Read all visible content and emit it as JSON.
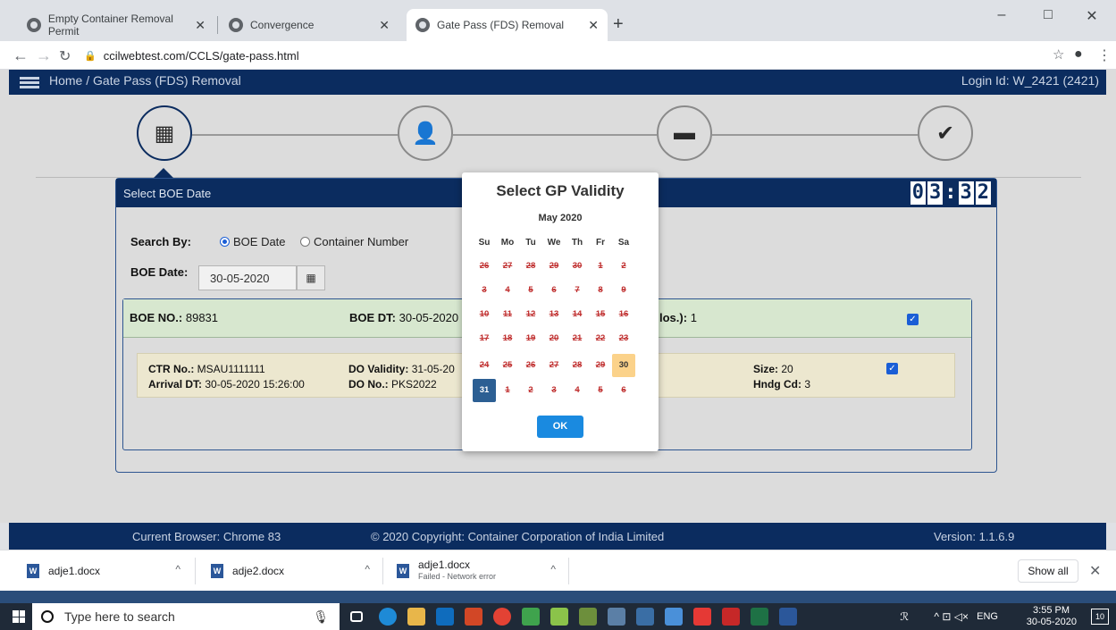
{
  "browser": {
    "tabs": [
      {
        "title": "Empty Container Removal Permit"
      },
      {
        "title": "Convergence"
      },
      {
        "title": "Gate Pass (FDS) Removal"
      }
    ],
    "new_tab": "+",
    "url": "ccilwebtest.com/CCLS/gate-pass.html",
    "win_min": "–",
    "win_max": "□",
    "win_close": "✕"
  },
  "header": {
    "breadcrumb": "Home / Gate Pass (FDS) Removal",
    "login": "Login Id: W_2421 (2421)"
  },
  "panel": {
    "title": "Select BOE Date",
    "timer": {
      "m1": "0",
      "m2": "3",
      "s1": "3",
      "s2": "2"
    },
    "search_by_label": "Search By:",
    "radio_boe": "BOE Date",
    "radio_container": "Container Number",
    "boe_date_label": "BOE Date:",
    "boe_date_value": "30-05-2020"
  },
  "boe_card": {
    "boe_no_label": "BOE NO.:",
    "boe_no_value": "89831",
    "boe_dt_label": "BOE DT:",
    "boe_dt_value": "30-05-2020",
    "nos_label": "los.):",
    "nos_value": "1"
  },
  "container": {
    "ctr_label": "CTR No.:",
    "ctr_value": "MSAU1111111",
    "arrival_label": "Arrival DT:",
    "arrival_value": "30-05-2020 15:26:00",
    "do_validity_label": "DO Validity:",
    "do_validity_value": "31-05-20",
    "do_no_label": "DO No.:",
    "do_no_value": "PKS2022",
    "size_label": "Size:",
    "size_value": "20",
    "hndg_label": "Hndg Cd:",
    "hndg_value": "3"
  },
  "footer": {
    "browser": "Current Browser: Chrome 83",
    "copyright": "© 2020 Copyright: Container Corporation of India Limited",
    "version": "Version: 1.1.6.9"
  },
  "modal": {
    "title": "Select GP Validity",
    "month": "May 2020",
    "dow": [
      "Su",
      "Mo",
      "Tu",
      "We",
      "Th",
      "Fr",
      "Sa"
    ],
    "weeks": [
      [
        "26",
        "27",
        "28",
        "29",
        "30",
        "1",
        "2"
      ],
      [
        "3",
        "4",
        "5",
        "6",
        "7",
        "8",
        "9"
      ],
      [
        "10",
        "11",
        "12",
        "13",
        "14",
        "15",
        "16"
      ],
      [
        "17",
        "18",
        "19",
        "20",
        "21",
        "22",
        "23"
      ],
      [
        "24",
        "25",
        "26",
        "27",
        "28",
        "29",
        "30"
      ],
      [
        "31",
        "1",
        "2",
        "3",
        "4",
        "5",
        "6"
      ]
    ],
    "today": "30",
    "selected": "31",
    "ok": "OK"
  },
  "downloads": {
    "items": [
      {
        "name": "adje1.docx",
        "status": ""
      },
      {
        "name": "adje2.docx",
        "status": ""
      },
      {
        "name": "adje1.docx",
        "status": "Failed - Network error"
      }
    ],
    "show_all": "Show all"
  },
  "taskbar": {
    "search_placeholder": "Type here to search",
    "lang": "ENG",
    "time": "3:55 PM",
    "date": "30-05-2020",
    "notif": "10"
  }
}
